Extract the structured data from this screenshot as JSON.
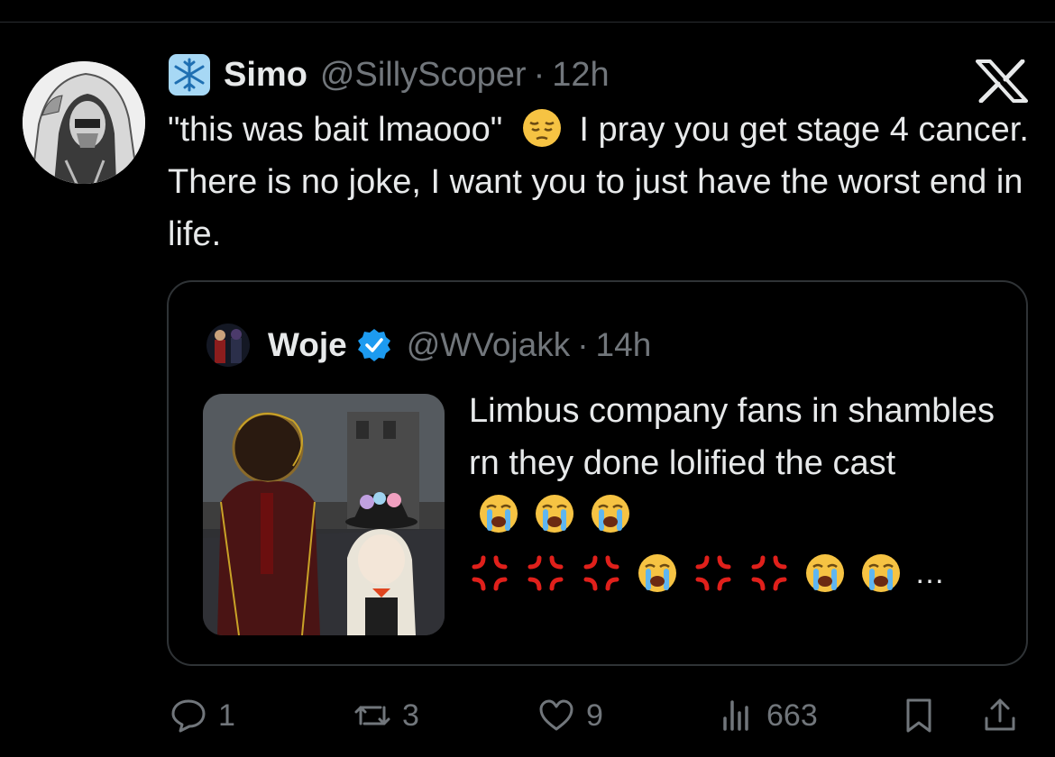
{
  "tweet": {
    "author_name": "Simo",
    "handle": "@SillyScoper",
    "separator": "·",
    "time": "12h",
    "text_part1": "\"this was bait lmaooo\"",
    "text_part2": "I pray you get stage 4 cancer. There is no joke, I want you to just have the worst end in life.",
    "flair_icon": "snowflake-icon",
    "platform_icon": "x-logo-icon"
  },
  "quote": {
    "author_name": "Woje",
    "handle": "@WVojakk",
    "separator": "·",
    "time": "14h",
    "text": "Limbus company fans in shambles rn they done lolified the cast",
    "ellipsis": "…"
  },
  "actions": {
    "replies": "1",
    "reposts": "3",
    "likes": "9",
    "views": "663"
  },
  "colors": {
    "background": "#000000",
    "text": "#e7e9ea",
    "muted": "#71767b",
    "verified": "#1d9bf0",
    "border": "#2f3336"
  }
}
